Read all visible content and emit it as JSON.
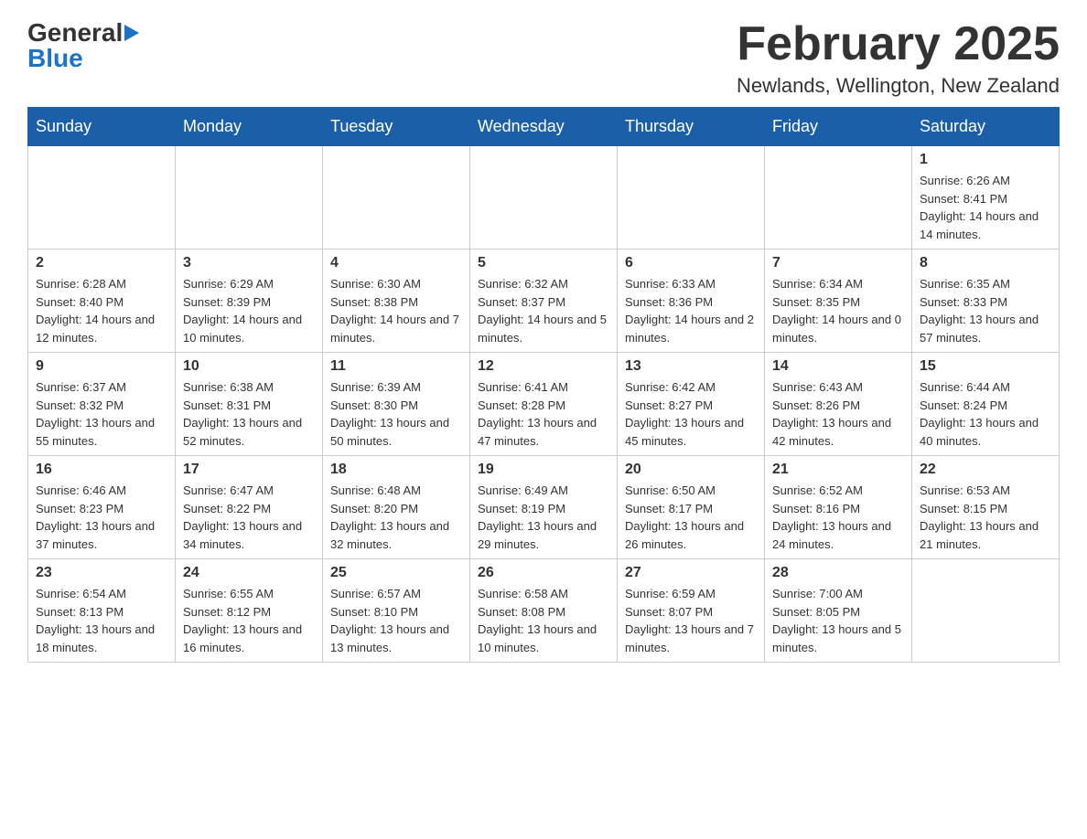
{
  "logo": {
    "line1": "General",
    "arrow": "▶",
    "line2": "Blue"
  },
  "calendar": {
    "title": "February 2025",
    "subtitle": "Newlands, Wellington, New Zealand",
    "days_of_week": [
      "Sunday",
      "Monday",
      "Tuesday",
      "Wednesday",
      "Thursday",
      "Friday",
      "Saturday"
    ],
    "weeks": [
      [
        {
          "day": "",
          "info": ""
        },
        {
          "day": "",
          "info": ""
        },
        {
          "day": "",
          "info": ""
        },
        {
          "day": "",
          "info": ""
        },
        {
          "day": "",
          "info": ""
        },
        {
          "day": "",
          "info": ""
        },
        {
          "day": "1",
          "info": "Sunrise: 6:26 AM\nSunset: 8:41 PM\nDaylight: 14 hours and 14 minutes."
        }
      ],
      [
        {
          "day": "2",
          "info": "Sunrise: 6:28 AM\nSunset: 8:40 PM\nDaylight: 14 hours and 12 minutes."
        },
        {
          "day": "3",
          "info": "Sunrise: 6:29 AM\nSunset: 8:39 PM\nDaylight: 14 hours and 10 minutes."
        },
        {
          "day": "4",
          "info": "Sunrise: 6:30 AM\nSunset: 8:38 PM\nDaylight: 14 hours and 7 minutes."
        },
        {
          "day": "5",
          "info": "Sunrise: 6:32 AM\nSunset: 8:37 PM\nDaylight: 14 hours and 5 minutes."
        },
        {
          "day": "6",
          "info": "Sunrise: 6:33 AM\nSunset: 8:36 PM\nDaylight: 14 hours and 2 minutes."
        },
        {
          "day": "7",
          "info": "Sunrise: 6:34 AM\nSunset: 8:35 PM\nDaylight: 14 hours and 0 minutes."
        },
        {
          "day": "8",
          "info": "Sunrise: 6:35 AM\nSunset: 8:33 PM\nDaylight: 13 hours and 57 minutes."
        }
      ],
      [
        {
          "day": "9",
          "info": "Sunrise: 6:37 AM\nSunset: 8:32 PM\nDaylight: 13 hours and 55 minutes."
        },
        {
          "day": "10",
          "info": "Sunrise: 6:38 AM\nSunset: 8:31 PM\nDaylight: 13 hours and 52 minutes."
        },
        {
          "day": "11",
          "info": "Sunrise: 6:39 AM\nSunset: 8:30 PM\nDaylight: 13 hours and 50 minutes."
        },
        {
          "day": "12",
          "info": "Sunrise: 6:41 AM\nSunset: 8:28 PM\nDaylight: 13 hours and 47 minutes."
        },
        {
          "day": "13",
          "info": "Sunrise: 6:42 AM\nSunset: 8:27 PM\nDaylight: 13 hours and 45 minutes."
        },
        {
          "day": "14",
          "info": "Sunrise: 6:43 AM\nSunset: 8:26 PM\nDaylight: 13 hours and 42 minutes."
        },
        {
          "day": "15",
          "info": "Sunrise: 6:44 AM\nSunset: 8:24 PM\nDaylight: 13 hours and 40 minutes."
        }
      ],
      [
        {
          "day": "16",
          "info": "Sunrise: 6:46 AM\nSunset: 8:23 PM\nDaylight: 13 hours and 37 minutes."
        },
        {
          "day": "17",
          "info": "Sunrise: 6:47 AM\nSunset: 8:22 PM\nDaylight: 13 hours and 34 minutes."
        },
        {
          "day": "18",
          "info": "Sunrise: 6:48 AM\nSunset: 8:20 PM\nDaylight: 13 hours and 32 minutes."
        },
        {
          "day": "19",
          "info": "Sunrise: 6:49 AM\nSunset: 8:19 PM\nDaylight: 13 hours and 29 minutes."
        },
        {
          "day": "20",
          "info": "Sunrise: 6:50 AM\nSunset: 8:17 PM\nDaylight: 13 hours and 26 minutes."
        },
        {
          "day": "21",
          "info": "Sunrise: 6:52 AM\nSunset: 8:16 PM\nDaylight: 13 hours and 24 minutes."
        },
        {
          "day": "22",
          "info": "Sunrise: 6:53 AM\nSunset: 8:15 PM\nDaylight: 13 hours and 21 minutes."
        }
      ],
      [
        {
          "day": "23",
          "info": "Sunrise: 6:54 AM\nSunset: 8:13 PM\nDaylight: 13 hours and 18 minutes."
        },
        {
          "day": "24",
          "info": "Sunrise: 6:55 AM\nSunset: 8:12 PM\nDaylight: 13 hours and 16 minutes."
        },
        {
          "day": "25",
          "info": "Sunrise: 6:57 AM\nSunset: 8:10 PM\nDaylight: 13 hours and 13 minutes."
        },
        {
          "day": "26",
          "info": "Sunrise: 6:58 AM\nSunset: 8:08 PM\nDaylight: 13 hours and 10 minutes."
        },
        {
          "day": "27",
          "info": "Sunrise: 6:59 AM\nSunset: 8:07 PM\nDaylight: 13 hours and 7 minutes."
        },
        {
          "day": "28",
          "info": "Sunrise: 7:00 AM\nSunset: 8:05 PM\nDaylight: 13 hours and 5 minutes."
        },
        {
          "day": "",
          "info": ""
        }
      ]
    ]
  }
}
